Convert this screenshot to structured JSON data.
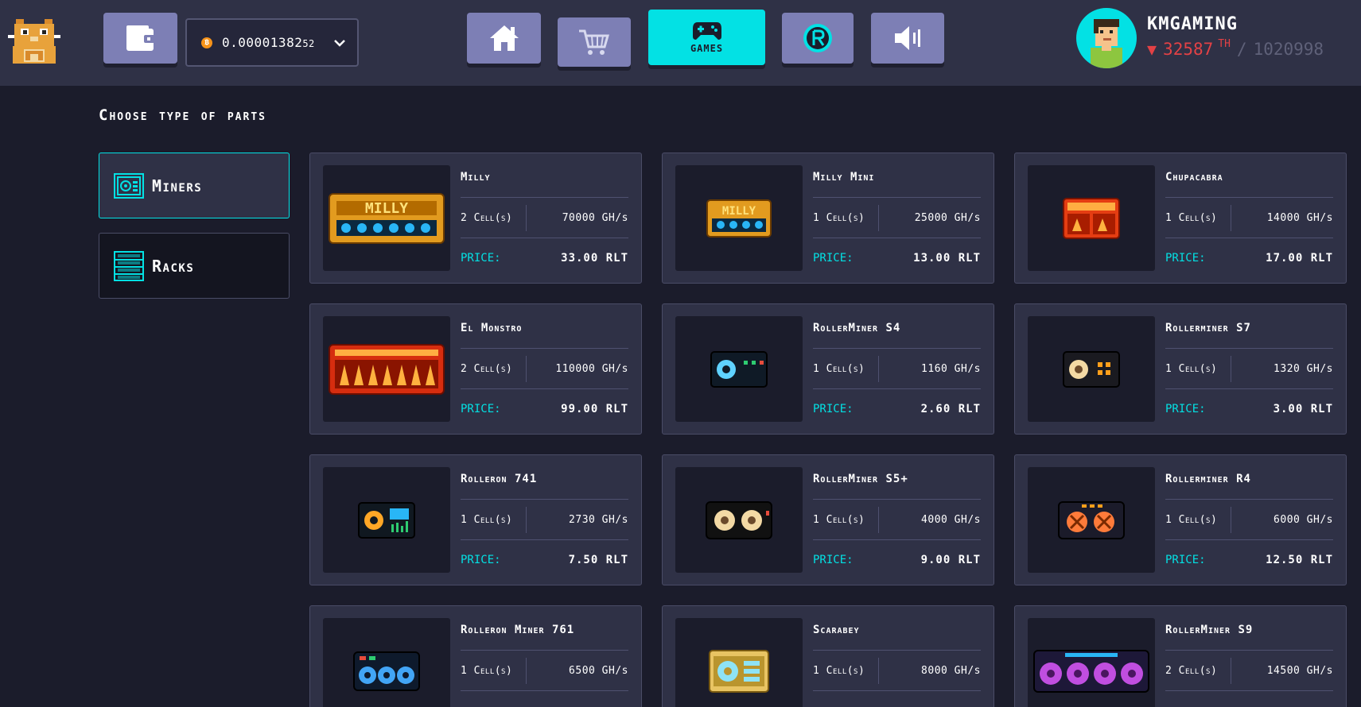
{
  "header": {
    "balance": {
      "main": "0.00001382",
      "small": "52"
    },
    "games_label": "GAMES",
    "user": {
      "name": "KMGAMING",
      "rank": "32587",
      "rank_suffix": "TH",
      "rank_total": "1020998"
    }
  },
  "section_title": "Choose type of parts",
  "categories": [
    {
      "label": "Miners",
      "selected": true
    },
    {
      "label": "Racks",
      "selected": false
    }
  ],
  "price_label": "PRICE:",
  "cards": [
    {
      "name": "Milly",
      "cells": "2 Cell(s)",
      "power": "70000 GH/s",
      "price": "33.00 RLT",
      "art": "milly"
    },
    {
      "name": "Milly Mini",
      "cells": "1 Cell(s)",
      "power": "25000 GH/s",
      "price": "13.00 RLT",
      "art": "milly-mini"
    },
    {
      "name": "Chupacabra",
      "cells": "1 Cell(s)",
      "power": "14000 GH/s",
      "price": "17.00 RLT",
      "art": "chupacabra"
    },
    {
      "name": "El Monstro",
      "cells": "2 Cell(s)",
      "power": "110000 GH/s",
      "price": "99.00 RLT",
      "art": "el-monstro"
    },
    {
      "name": "RollerMiner S4",
      "cells": "1 Cell(s)",
      "power": "1160 GH/s",
      "price": "2.60 RLT",
      "art": "s4"
    },
    {
      "name": "Rollerminer S7",
      "cells": "1 Cell(s)",
      "power": "1320 GH/s",
      "price": "3.00 RLT",
      "art": "s7"
    },
    {
      "name": "Rolleron 741",
      "cells": "1 Cell(s)",
      "power": "2730 GH/s",
      "price": "7.50 RLT",
      "art": "r741"
    },
    {
      "name": "RollerMiner S5+",
      "cells": "1 Cell(s)",
      "power": "4000 GH/s",
      "price": "9.00 RLT",
      "art": "s5"
    },
    {
      "name": "Rollerminer R4",
      "cells": "1 Cell(s)",
      "power": "6000 GH/s",
      "price": "12.50 RLT",
      "art": "r4"
    },
    {
      "name": "Rolleron Miner 761",
      "cells": "1 Cell(s)",
      "power": "6500 GH/s",
      "price": "",
      "art": "r761"
    },
    {
      "name": "Scarabey",
      "cells": "1 Cell(s)",
      "power": "8000 GH/s",
      "price": "",
      "art": "scarabey"
    },
    {
      "name": "RollerMiner S9",
      "cells": "2 Cell(s)",
      "power": "14500 GH/s",
      "price": "",
      "art": "s9"
    }
  ]
}
